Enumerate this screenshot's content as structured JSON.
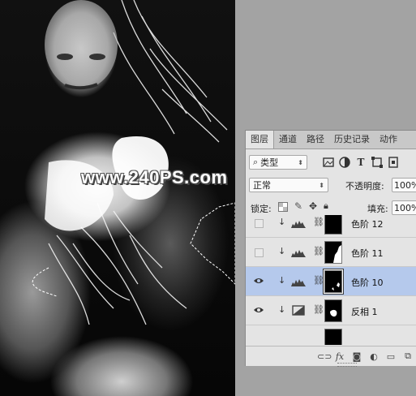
{
  "watermark": "www.240PS.com",
  "panel": {
    "tabs": [
      "图层",
      "通道",
      "路径",
      "历史记录",
      "动作"
    ],
    "filter": {
      "label": "类型"
    },
    "blend_mode": "正常",
    "opacity": {
      "label": "不透明度:",
      "value": "100%"
    },
    "lock": {
      "label": "锁定:"
    },
    "fill": {
      "label": "填充:",
      "value": "100%"
    },
    "layers": [
      {
        "name": "色阶 12",
        "visible": false,
        "type": "levels"
      },
      {
        "name": "色阶 11",
        "visible": false,
        "type": "levels"
      },
      {
        "name": "色阶 10",
        "visible": true,
        "type": "levels",
        "selected": true
      },
      {
        "name": "反相 1",
        "visible": true,
        "type": "invert"
      }
    ],
    "footer_icons": [
      "link-icon",
      "fx-icon",
      "add-mask-icon",
      "adjustment-icon",
      "group-folder-icon",
      "new-layer-icon"
    ]
  },
  "colors": {
    "selection": "#b5c9ec",
    "panel": "#e4e4e4",
    "workspace": "#a3a3a3"
  }
}
